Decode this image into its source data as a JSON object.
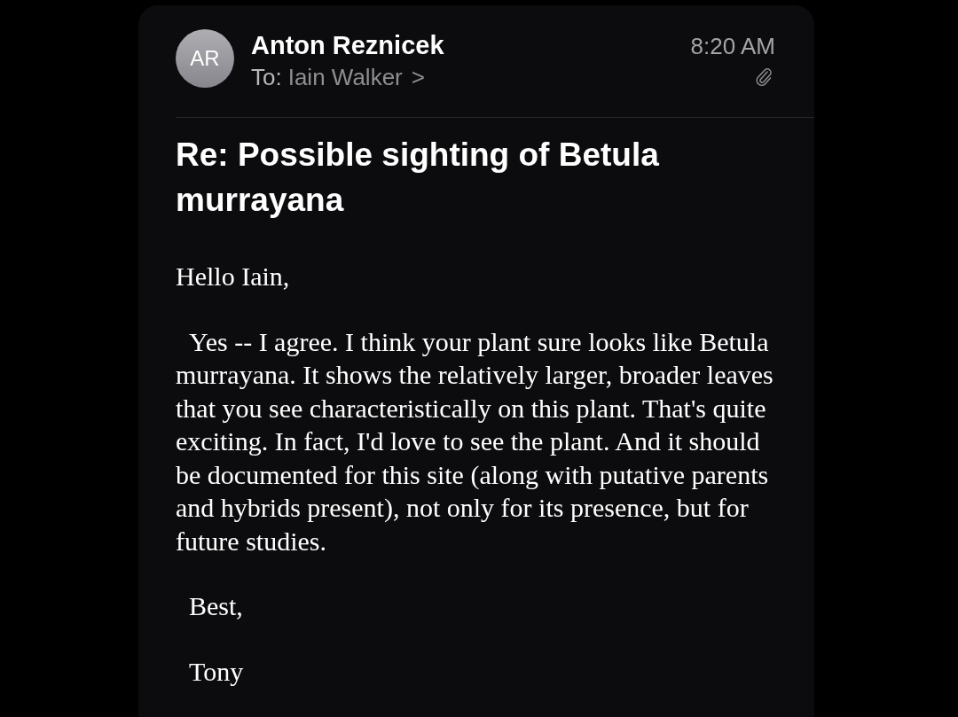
{
  "header": {
    "avatar": "AR",
    "sender": "Anton Reznicek",
    "to_label": "To:",
    "recipient": "Iain Walker",
    "chevron": ">",
    "time": "8:20 AM",
    "has_attachment": true
  },
  "subject": "Re: Possible sighting of Betula murrayana",
  "body": [
    "Hello Iain,",
    "  Yes -- I agree. I think your plant sure looks like Betula murrayana. It shows the relatively larger, broader leaves that you see characteristically on this plant. That's quite exciting. In fact, I'd love to see the plant. And it should be documented for this site (along with putative parents and hybrids present), not only for its presence, but for future studies.",
    "  Best,",
    "  Tony"
  ]
}
